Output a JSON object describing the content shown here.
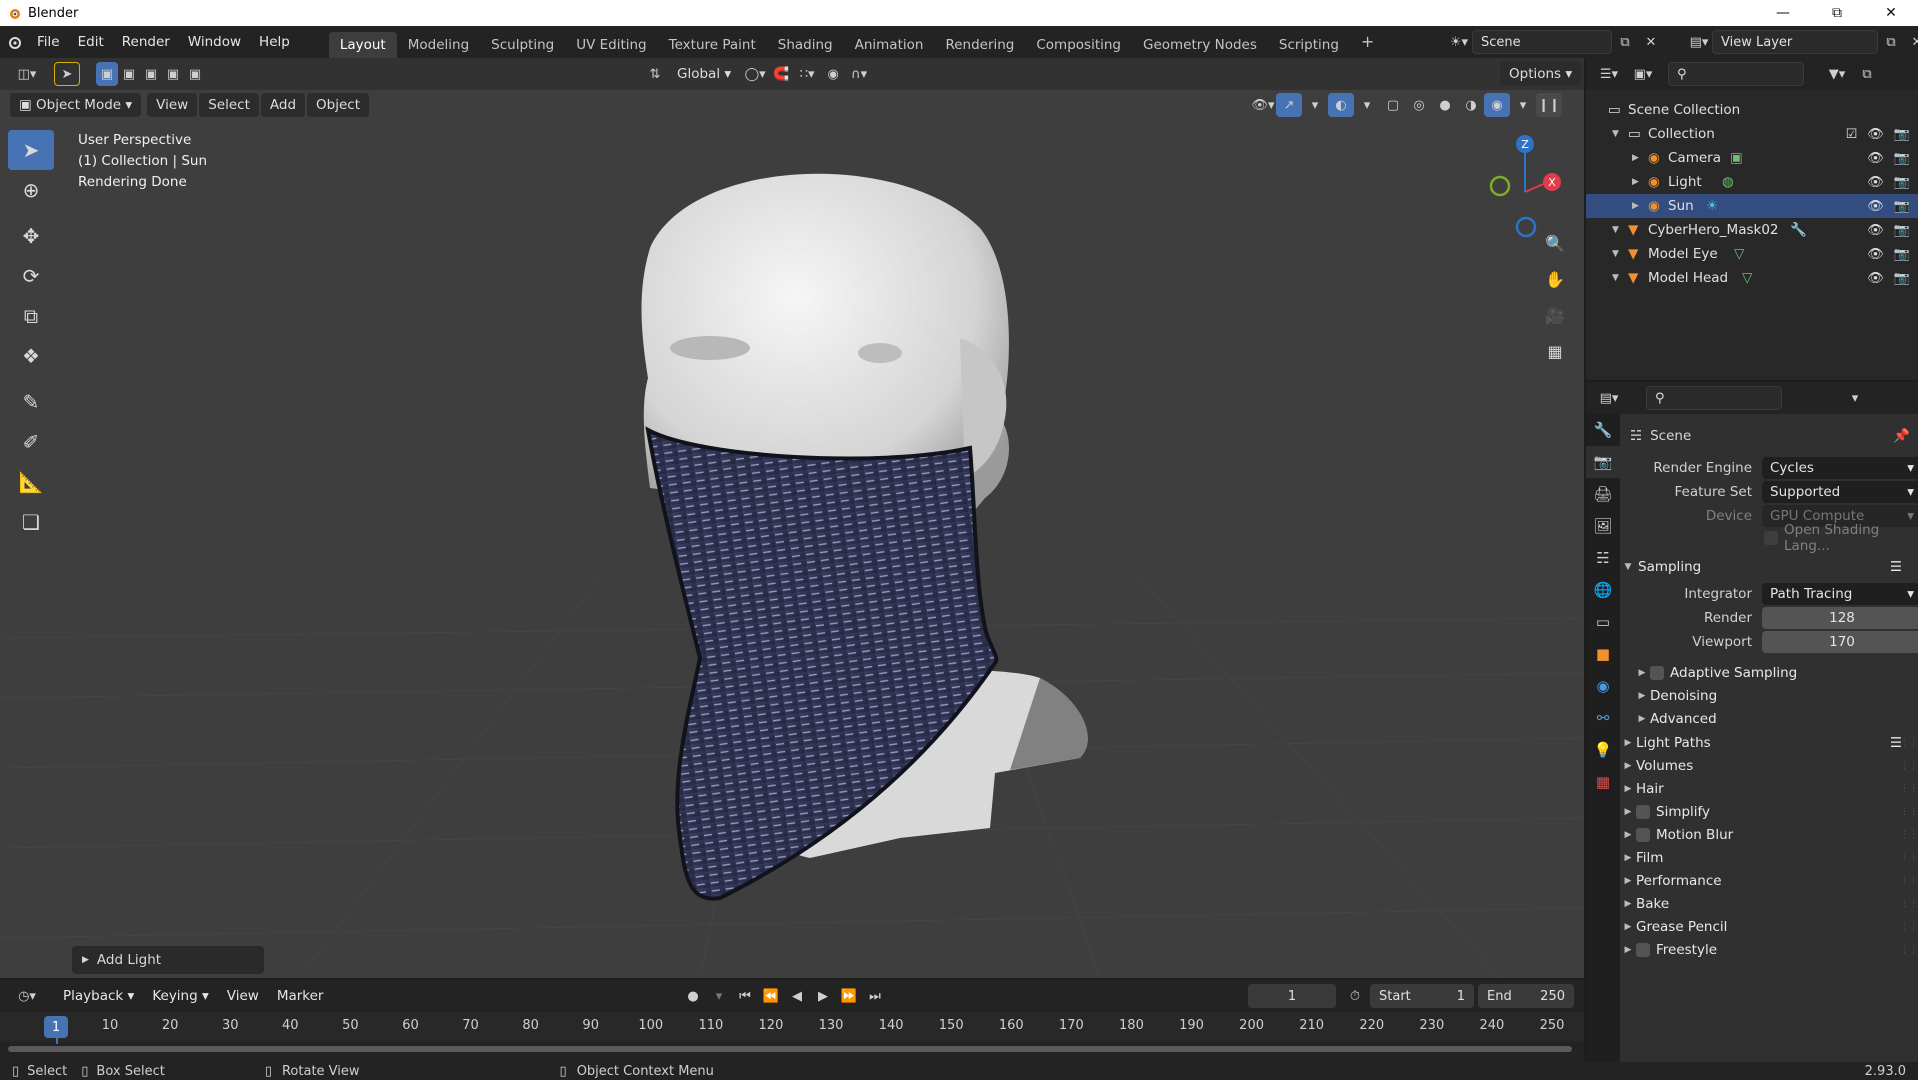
{
  "window": {
    "title": "Blender"
  },
  "menu": [
    "File",
    "Edit",
    "Render",
    "Window",
    "Help"
  ],
  "workspaces": [
    "Layout",
    "Modeling",
    "Sculpting",
    "UV Editing",
    "Texture Paint",
    "Shading",
    "Animation",
    "Rendering",
    "Compositing",
    "Geometry Nodes",
    "Scripting"
  ],
  "active_workspace": "Layout",
  "scene_field": "Scene",
  "view_layer_field": "View Layer",
  "viewport": {
    "transform_orientation": "Global",
    "options_label": "Options",
    "mode": "Object Mode",
    "header_menus": [
      "View",
      "Select",
      "Add",
      "Object"
    ],
    "overlay_lines": [
      "User Perspective",
      "(1) Collection | Sun",
      "Rendering Done"
    ],
    "gizmo": {
      "z": "Z",
      "x": "X"
    },
    "last_operator": "Add Light"
  },
  "outliner": {
    "rows": [
      {
        "label": "Scene Collection",
        "indent": 0
      },
      {
        "label": "Collection",
        "indent": 1
      },
      {
        "label": "Camera",
        "indent": 2
      },
      {
        "label": "Light",
        "indent": 2
      },
      {
        "label": "Sun",
        "indent": 2,
        "selected": true
      },
      {
        "label": "CyberHero_Mask02",
        "indent": 1
      },
      {
        "label": "Model Eye",
        "indent": 1
      },
      {
        "label": "Model Head",
        "indent": 1
      }
    ]
  },
  "properties": {
    "context": "Scene",
    "render_engine_label": "Render Engine",
    "render_engine": "Cycles",
    "feature_set_label": "Feature Set",
    "feature_set": "Supported",
    "device_label": "Device",
    "device": "GPU Compute",
    "osl_label": "Open Shading Lang...",
    "sampling": "Sampling",
    "integrator_label": "Integrator",
    "integrator": "Path Tracing",
    "render_label": "Render",
    "render_samples": "128",
    "viewport_label": "Viewport",
    "viewport_samples": "170",
    "subsections": [
      "Adaptive Sampling",
      "Denoising",
      "Advanced"
    ],
    "panels": [
      "Light Paths",
      "Volumes",
      "Hair",
      "Simplify",
      "Motion Blur",
      "Film",
      "Performance",
      "Bake",
      "Grease Pencil",
      "Freestyle"
    ]
  },
  "timeline": {
    "menus": [
      "Playback",
      "Keying",
      "View",
      "Marker"
    ],
    "current_frame": "1",
    "start_label": "Start",
    "start": "1",
    "end_label": "End",
    "end": "250",
    "ruler": [
      "1",
      "10",
      "20",
      "30",
      "40",
      "50",
      "60",
      "70",
      "80",
      "90",
      "100",
      "110",
      "120",
      "130",
      "140",
      "150",
      "160",
      "170",
      "180",
      "190",
      "200",
      "210",
      "220",
      "230",
      "240",
      "250"
    ]
  },
  "status": {
    "select": "Select",
    "box_select": "Box Select",
    "rotate_view": "Rotate View",
    "context_menu": "Object Context Menu",
    "version": "2.93.0"
  }
}
